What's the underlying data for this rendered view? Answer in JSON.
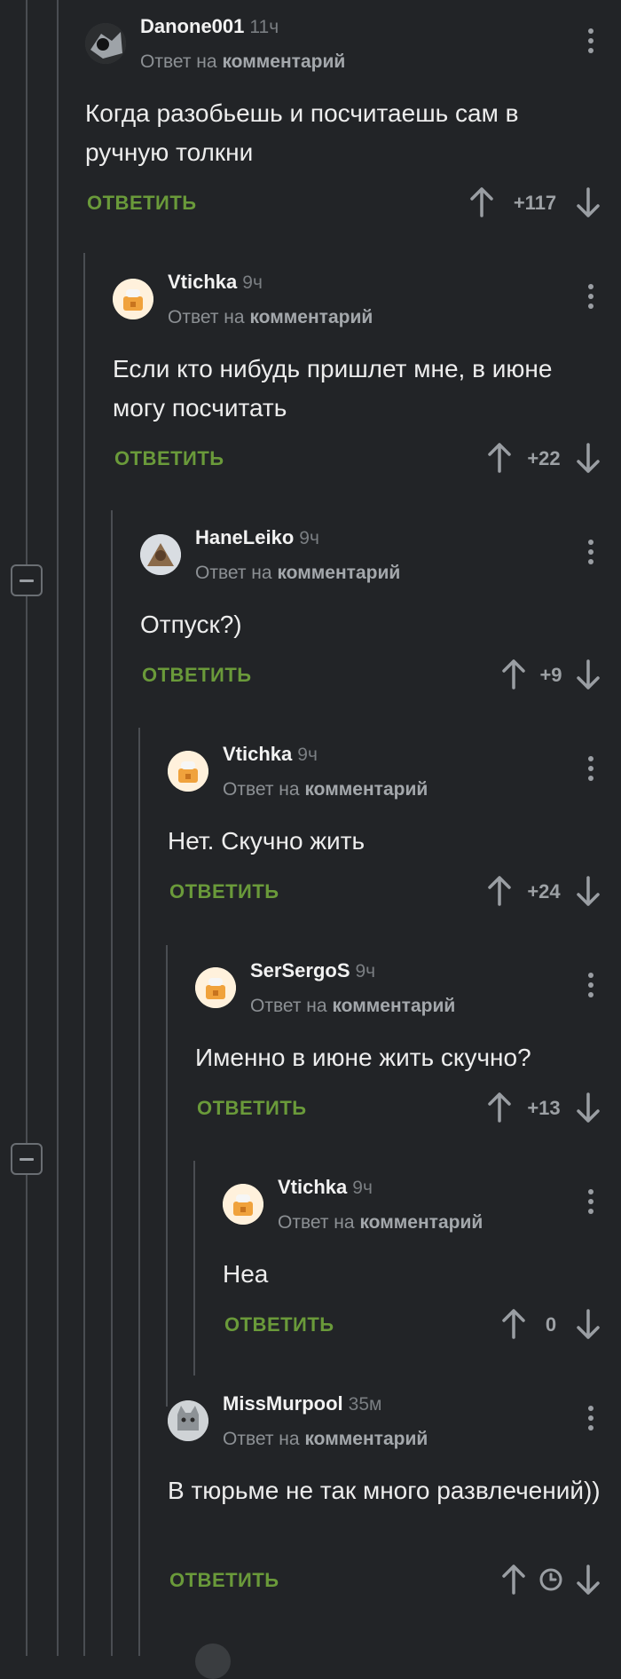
{
  "ui": {
    "reply_label": "ОТВЕТИТЬ",
    "reply_to_prefix": "Ответ на",
    "reply_to_link": "комментарий"
  },
  "comments": [
    {
      "author": "Danone001",
      "time": "11ч",
      "text": "Когда разобьешь и посчитаешь сам в ручную толкни",
      "score": "+117"
    },
    {
      "author": "Vtichka",
      "time": "9ч",
      "text": "Если кто нибудь пришлет мне, в июне могу посчитать",
      "score": "+22"
    },
    {
      "author": "HaneLeiko",
      "time": "9ч",
      "text": "Отпуск?)",
      "score": "+9"
    },
    {
      "author": "Vtichka",
      "time": "9ч",
      "text": "Нет. Скучно жить",
      "score": "+24"
    },
    {
      "author": "SerSergoS",
      "time": "9ч",
      "text": "Именно в июне жить скучно?",
      "score": "+13"
    },
    {
      "author": "Vtichka",
      "time": "9ч",
      "text": "Неа",
      "score": "0"
    },
    {
      "author": "MissMurpool",
      "time": "35м",
      "text": "В тюрьме не так много развлечений))",
      "score": ""
    }
  ],
  "icons": {
    "collapse": "minus-square-icon",
    "upvote": "arrow-up-icon",
    "downvote": "arrow-down-icon",
    "menu": "more-vertical-icon",
    "pending": "clock-icon"
  },
  "colors": {
    "background": "#222427",
    "reply": "#6a9a3a",
    "text": "#ededed"
  }
}
